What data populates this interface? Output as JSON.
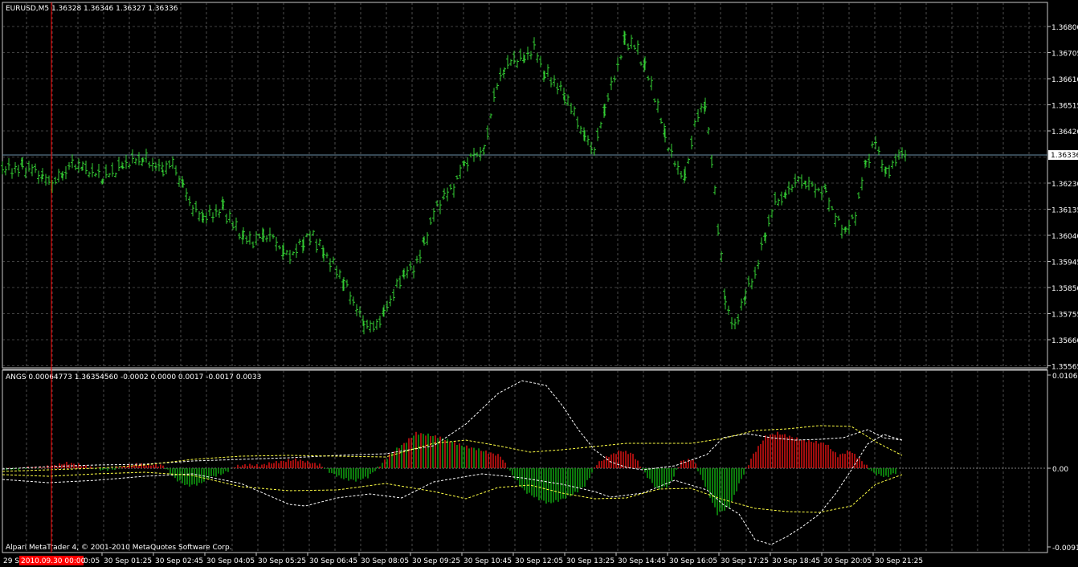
{
  "header": {
    "main_info": "EURUSD,M5  1.36328 1.36346 1.36327 1.36336",
    "indicator_info": "ANGS 0.00064773 1.36354560 -0.0002 0.0000 0.0017 -0.0017 0.0033",
    "copyright": "Alpari MetaTrader 4, © 2001-2010 MetaQuotes Software Corp."
  },
  "price_axis": {
    "ticks": [
      "1.36800",
      "1.36705",
      "1.36610",
      "1.36515",
      "1.36420",
      "1.36230",
      "1.36135",
      "1.36040",
      "1.35945",
      "1.35850",
      "1.35755",
      "1.35660",
      "1.35565"
    ],
    "current_price": "1.36336"
  },
  "indicator_axis": {
    "ticks": [
      "0.0106",
      "0.00",
      "-0.0091"
    ]
  },
  "time_axis": {
    "first_label": "29 S",
    "highlight_label": "2010.09.30 00:00",
    "partial_label": "0:05",
    "labels": [
      "30 Sep 01:25",
      "30 Sep 02:45",
      "30 Sep 04:05",
      "30 Sep 05:25",
      "30 Sep 06:45",
      "30 Sep 08:05",
      "30 Sep 09:25",
      "30 Sep 10:45",
      "30 Sep 12:05",
      "30 Sep 13:25",
      "30 Sep 14:45",
      "30 Sep 16:05",
      "30 Sep 17:25",
      "30 Sep 18:45",
      "30 Sep 20:05",
      "30 Sep 21:25"
    ]
  },
  "colors": {
    "background": "#000000",
    "grid": "#808080",
    "bars": "#33cc33",
    "hist_up": "#cc1111",
    "hist_down": "#109910",
    "bands": "#ffffff",
    "bands_alt": "#ffff44",
    "current_line": "#6b8fa8",
    "highlight": "#ff0000"
  },
  "chart_data": [
    {
      "type": "line",
      "title": "EURUSD,M5",
      "series": [
        {
          "name": "EURUSD",
          "x": [
            0,
            12,
            25,
            37,
            50,
            62,
            75,
            87,
            100,
            112,
            125,
            137,
            150,
            162,
            175,
            187,
            200,
            212,
            225,
            237,
            250,
            262,
            275,
            287,
            300,
            312,
            325,
            337,
            350,
            362,
            375,
            387,
            400,
            412,
            425,
            437,
            450,
            462,
            475,
            487,
            500,
            512,
            525,
            537,
            550,
            562,
            575,
            587,
            600,
            612,
            625,
            637,
            650,
            662,
            675,
            687,
            700,
            712,
            725,
            737,
            750,
            762,
            775,
            787,
            800,
            812,
            825,
            837,
            850,
            862,
            875,
            887,
            900,
            912,
            925,
            937,
            950,
            962,
            975,
            987,
            1000,
            1012,
            1025,
            1037,
            1050,
            1062,
            1075,
            1087,
            1100,
            1112,
            1125
          ],
          "values": [
            1.3628,
            1.3628,
            1.3629,
            1.3628,
            1.3625,
            1.3623,
            1.3626,
            1.363,
            1.3629,
            1.3627,
            1.3625,
            1.3627,
            1.363,
            1.3631,
            1.3632,
            1.363,
            1.3628,
            1.363,
            1.3622,
            1.3614,
            1.361,
            1.3612,
            1.3614,
            1.3608,
            1.3603,
            1.3602,
            1.3604,
            1.3603,
            1.3598,
            1.3597,
            1.3602,
            1.3604,
            1.3598,
            1.3593,
            1.3587,
            1.358,
            1.3572,
            1.357,
            1.3576,
            1.3583,
            1.359,
            1.3592,
            1.3601,
            1.3612,
            1.3618,
            1.3622,
            1.363,
            1.3633,
            1.3635,
            1.3655,
            1.3665,
            1.3668,
            1.3669,
            1.3672,
            1.3663,
            1.366,
            1.3655,
            1.3648,
            1.364,
            1.3635,
            1.365,
            1.3662,
            1.3675,
            1.3673,
            1.3665,
            1.3655,
            1.364,
            1.363,
            1.3625,
            1.3645,
            1.3652,
            1.362,
            1.358,
            1.357,
            1.3583,
            1.359,
            1.3605,
            1.3616,
            1.3619,
            1.3624,
            1.3623,
            1.3621,
            1.362,
            1.361,
            1.3605,
            1.3612,
            1.363,
            1.3638,
            1.3626,
            1.3632,
            1.3634
          ]
        }
      ]
    },
    {
      "type": "bar",
      "title": "ANGS",
      "series": [
        {
          "x": [
            5,
            20,
            35,
            50,
            65,
            80,
            95,
            110,
            125,
            140,
            155,
            170,
            185,
            200,
            215,
            230,
            245,
            260,
            275,
            290,
            305,
            320,
            335,
            350,
            365,
            380,
            395,
            410,
            425,
            440,
            455,
            470,
            485,
            500,
            515,
            530,
            545,
            560,
            575,
            590,
            605,
            620,
            635,
            650,
            665,
            680,
            695,
            710,
            725,
            740,
            755,
            770,
            785,
            800,
            815,
            830,
            845,
            860,
            875,
            890,
            905,
            920,
            935,
            950,
            965,
            980,
            995,
            1010,
            1025,
            1040,
            1055,
            1070,
            1085,
            1100,
            1115
          ],
          "values": [
            -0.0001,
            -0.0001,
            0.0001,
            0.0001,
            0.0003,
            0.0006,
            0.0004,
            0.0001,
            -0.0002,
            -0.0001,
            0.0003,
            0.0005,
            0.0004,
            0.0003,
            -0.0012,
            -0.002,
            -0.0018,
            -0.001,
            -0.0006,
            0.0002,
            0.0004,
            0.0003,
            0.0006,
            0.0008,
            0.001,
            0.0007,
            0.0004,
            -0.0006,
            -0.0012,
            -0.0014,
            -0.001,
            0.0003,
            0.0018,
            0.0028,
            0.004,
            0.0038,
            0.0035,
            0.003,
            0.0025,
            0.0022,
            0.0018,
            0.0014,
            -0.0008,
            -0.0026,
            -0.0034,
            -0.004,
            -0.0036,
            -0.003,
            -0.002,
            0.0005,
            0.0014,
            0.002,
            0.0016,
            -0.0006,
            -0.0024,
            -0.002,
            0.0008,
            0.001,
            -0.002,
            -0.0052,
            -0.0044,
            -0.0012,
            0.0016,
            0.0036,
            0.004,
            0.0036,
            0.0032,
            0.003,
            0.0028,
            0.0014,
            0.002,
            0.0008,
            -0.0006,
            -0.001,
            -0.0004
          ]
        }
      ]
    }
  ]
}
